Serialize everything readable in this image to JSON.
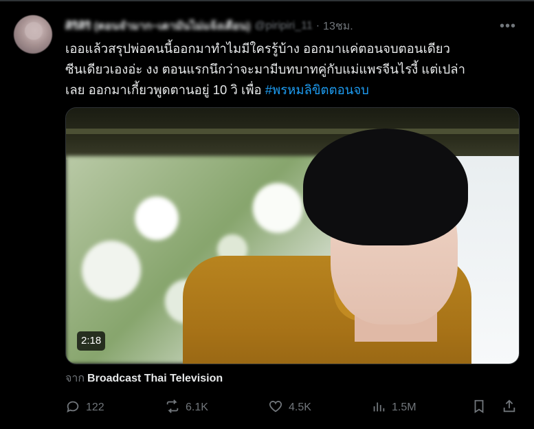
{
  "header": {
    "display_name": "ศิริศิริ (ตอนจำมาก~เดามันไม่แจ้งเตือน)",
    "handle": "@piripiri_11",
    "time": "13ชม.",
    "more_label": "•••"
  },
  "tweet": {
    "text_line1": "เออแล้วสรุปพ่อคนนี้ออกมาทำไมมีใครรู้บ้าง ออกมาแค่ตอนจบตอนเดียว",
    "text_line2": "ซีนเดียวเองอ่ะ งง ตอนแรกนึกว่าจะมามีบทบาทคู่กับแม่แพรจีนไรงี้ แต่เปล่า",
    "text_line3_prefix": "เลย ออกมาเกี้ยวพูดตานอยู่ 10 วิ เพื่อ ",
    "hashtag": "#พรหมลิขิตตอนจบ"
  },
  "media": {
    "duration": "2:18"
  },
  "source": {
    "prefix": "จาก",
    "name": "Broadcast Thai Television"
  },
  "actions": {
    "replies": "122",
    "reposts": "6.1K",
    "likes": "4.5K",
    "views": "1.5M"
  },
  "colors": {
    "background": "#000000",
    "text": "#e7e9ea",
    "muted": "#71767b",
    "link": "#1d9bf0"
  }
}
